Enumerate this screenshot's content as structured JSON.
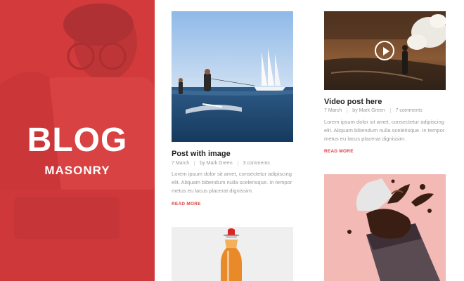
{
  "hero": {
    "title": "BLOG",
    "subtitle": "MASONRY",
    "accent_color": "#de3a3e"
  },
  "posts": [
    {
      "title": "Post with image",
      "date": "7 March",
      "author": "by Mark Green",
      "comments": "3 comments",
      "excerpt": "Lorem ipsum dolor sit amet, consectetur adipiscing elit. Aliquam bibendum nulla scelerisque. In tempor metus eu lacus placerat dignissim.",
      "read_more": "READ MORE",
      "image": "sailboat-waterski-photo"
    },
    {
      "title": "Video post here",
      "date": "7 March",
      "author": "by Mark Green",
      "comments": "7 comments",
      "excerpt": "Lorem ipsum dolor sit amet, consectetur adipiscing elit. Aliquam bibendum nulla scelerisque. In tempor metus eu lacus placerat dignissim.",
      "read_more": "READ MORE",
      "image": "smoke-flare-photo",
      "icon": "play-icon"
    },
    {
      "image": "juice-bottle-photo"
    },
    {
      "image": "chocolate-splash-photo"
    }
  ]
}
